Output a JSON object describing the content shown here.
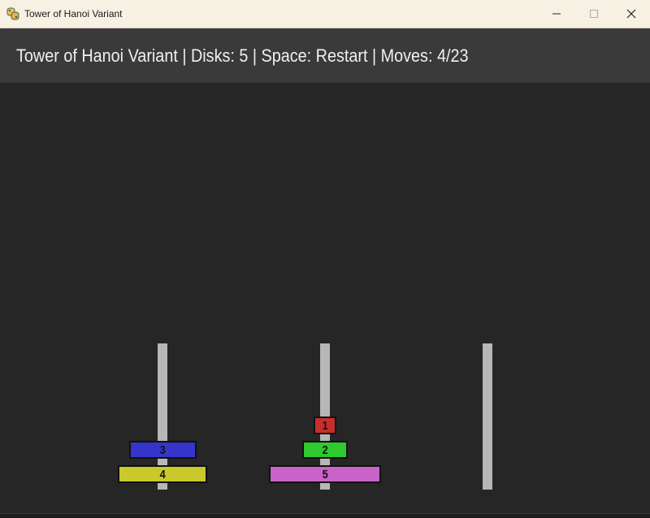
{
  "window": {
    "title": "Tower of Hanoi Variant"
  },
  "header": {
    "status_text": "Tower of Hanoi Variant | Disks: 5 | Space: Restart | Moves: 4/23"
  },
  "game": {
    "disk_count": 5,
    "moves_made": 4,
    "moves_limit": 23,
    "pegs": [
      {
        "disks": [
          {
            "label": "4",
            "size": 4,
            "color": "#c9c92c"
          },
          {
            "label": "3",
            "size": 3,
            "color": "#3535cc"
          }
        ]
      },
      {
        "disks": [
          {
            "label": "5",
            "size": 5,
            "color": "#c962c9"
          },
          {
            "label": "2",
            "size": 2,
            "color": "#2ec92e"
          },
          {
            "label": "1",
            "size": 1,
            "color": "#c92c2c"
          }
        ]
      },
      {
        "disks": []
      }
    ]
  },
  "colors": {
    "background": "#262626",
    "header_bg": "#3a3a3a",
    "peg": "#b7b7b7",
    "titlebar_bg": "#f7f1e3"
  },
  "icons": {
    "app": "python-snake-icon",
    "minimize": "minimize-icon",
    "maximize": "maximize-icon",
    "close": "close-icon"
  }
}
